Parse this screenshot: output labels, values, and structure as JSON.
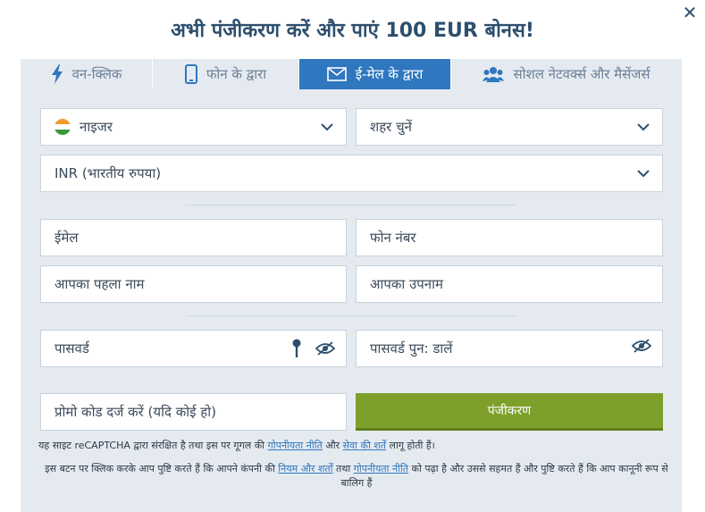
{
  "header": {
    "title": "अभी पंजीकरण करें और पाएं 100 EUR बोनस!",
    "close_glyph": "✕"
  },
  "tabs": [
    {
      "label": "वन-क्लिक",
      "icon": "lightning-icon",
      "active": false
    },
    {
      "label": "फोन के द्वारा",
      "icon": "phone-icon",
      "active": false
    },
    {
      "label": "ई-मेल के द्वारा",
      "icon": "envelope-icon",
      "active": true
    },
    {
      "label": "सोशल नेटवर्क्स और मैसेंजर्स",
      "icon": "users-icon",
      "active": false
    }
  ],
  "form": {
    "country": "नाइजर",
    "city_placeholder": "शहर चुनें",
    "currency": "INR (भारतीय रुपया)",
    "email_placeholder": "ईमेल",
    "phone_placeholder": "फोन नंबर",
    "first_name_placeholder": "आपका पहला नाम",
    "last_name_placeholder": "आपका उपनाम",
    "password_placeholder": "पासवर्ड",
    "password_repeat_placeholder": "पासवर्ड पुन: डालें",
    "promo_placeholder": "प्रोमो कोड दर्ज करें (यदि कोई हो)",
    "register_label": "पंजीकरण"
  },
  "notes": {
    "recaptcha_prefix": "यह साइट reCAPTCHA द्वारा संरक्षित है तथा इस पर गूगल की ",
    "privacy_link": "गोपनीयता नीति",
    "recaptcha_and": " और ",
    "terms_link": "सेवा की शर्तें",
    "recaptcha_suffix": " लागू होती हैं।",
    "consent_prefix": "इस बटन पर क्लिक करके आप पुष्टि करते हैं कि आपने कंपनी की ",
    "rules_link": "नियम और शर्तों",
    "consent_mid": " तथा ",
    "privacy_link2": "गोपनीयता नीति",
    "consent_suffix": " को पढ़ा है और उससे सहमत हैं और पुष्टि करते हैं कि आप कानूनी रूप से बालिग हैं"
  },
  "colors": {
    "accent": "#2f77bf",
    "register_button": "#7da02b",
    "title": "#2e4f6e"
  }
}
